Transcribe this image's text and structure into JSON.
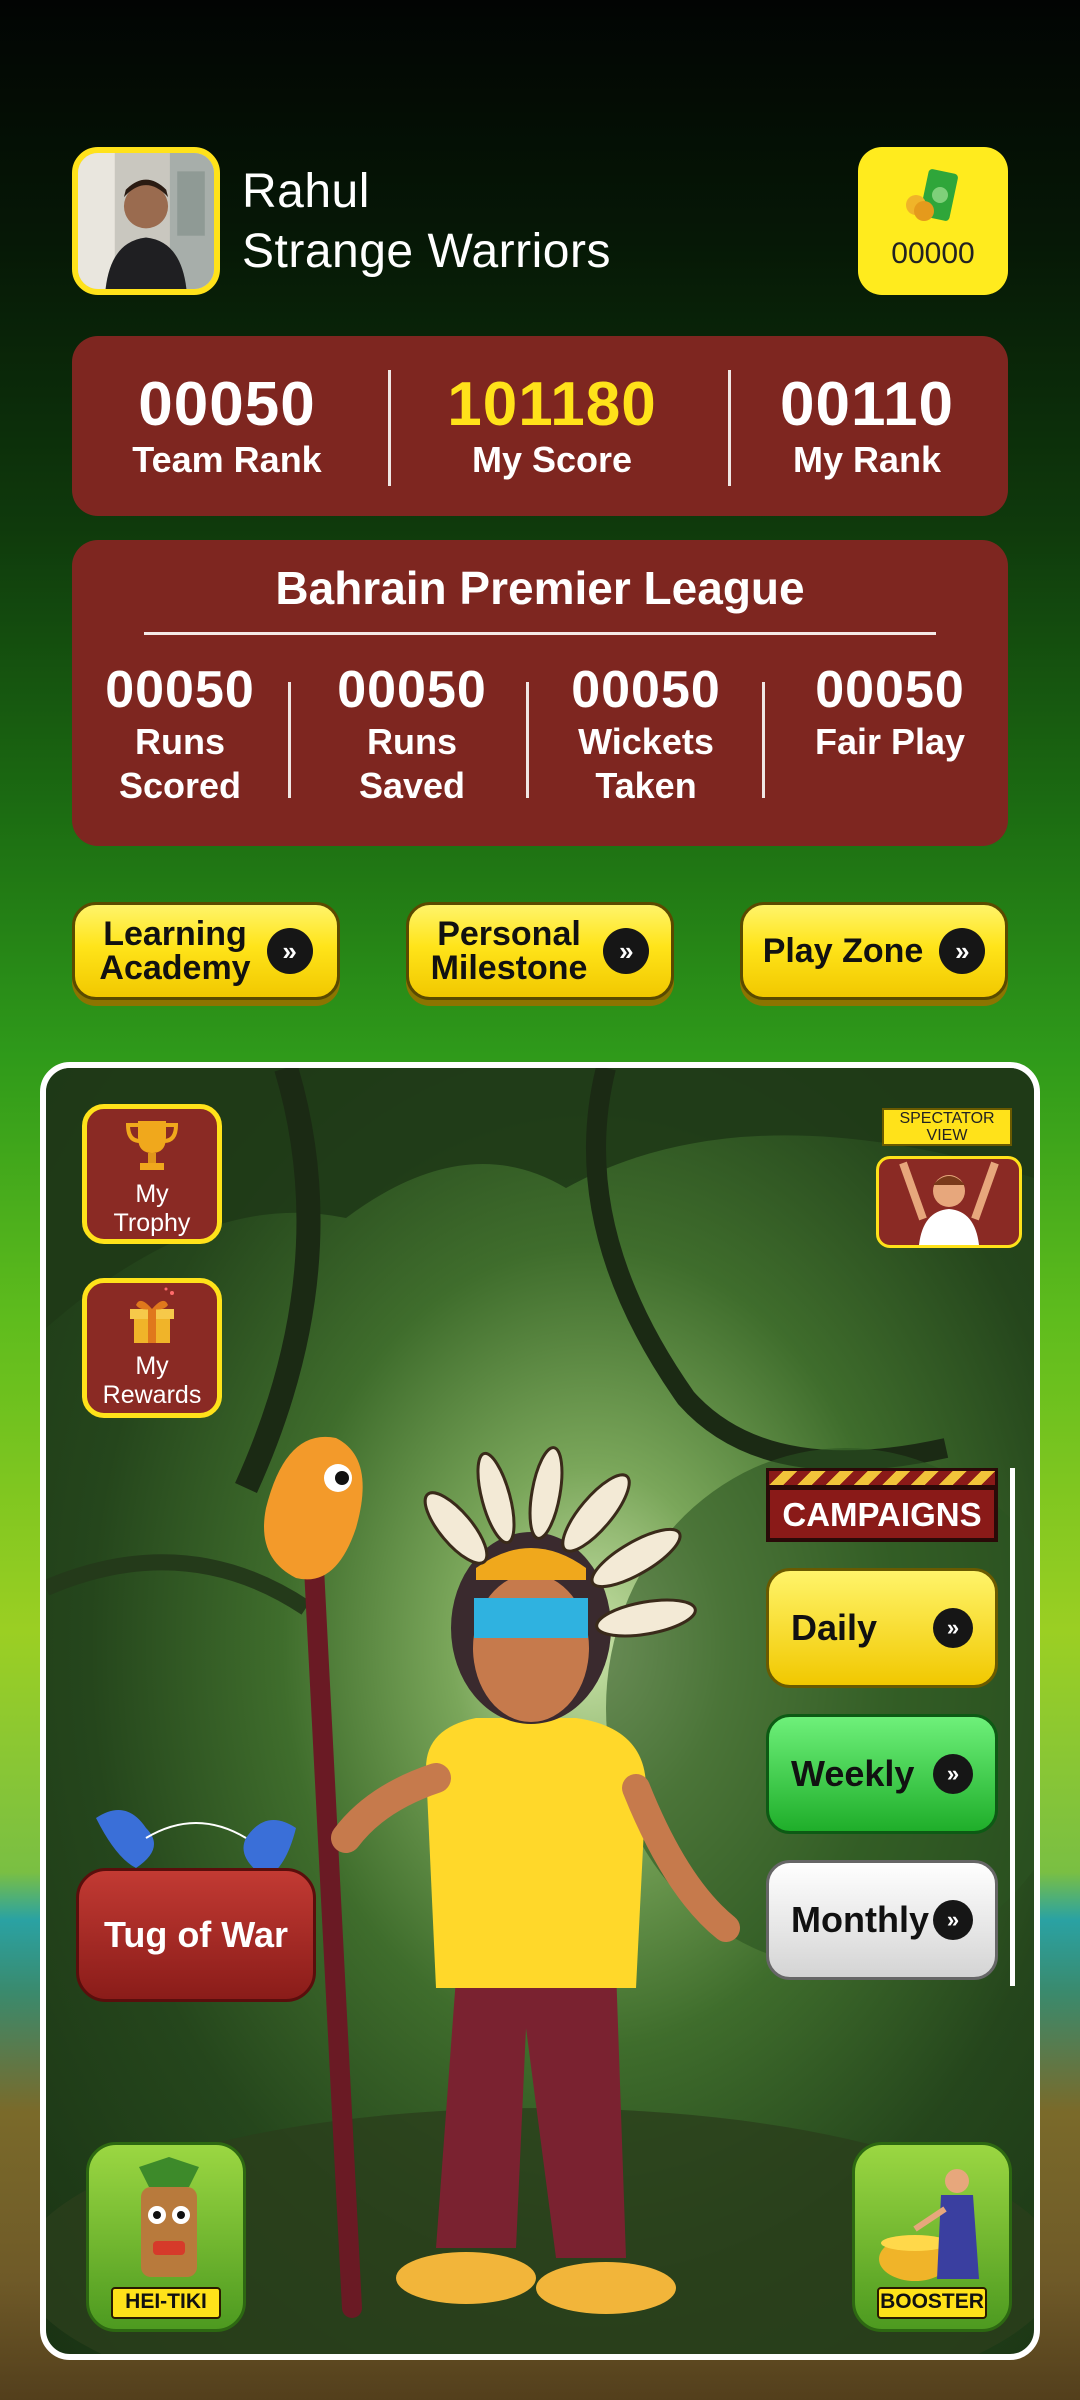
{
  "profile": {
    "name": "Rahul",
    "team": "Strange Warriors",
    "wallet_amount": "00000"
  },
  "scores": [
    {
      "value": "00050",
      "label": "Team Rank",
      "color": "#ffffff"
    },
    {
      "value": "101180",
      "label": "My Score",
      "color": "#ffe21a"
    },
    {
      "value": "00110",
      "label": "My Rank",
      "color": "#ffffff"
    }
  ],
  "league": {
    "title": "Bahrain Premier League",
    "stats": [
      {
        "value": "00050",
        "label1": "Runs",
        "label2": "Scored"
      },
      {
        "value": "00050",
        "label1": "Runs",
        "label2": "Saved"
      },
      {
        "value": "00050",
        "label1": "Wickets",
        "label2": "Taken"
      },
      {
        "value": "00050",
        "label1": "Fair Play",
        "label2": ""
      }
    ]
  },
  "nav": {
    "learning_line1": "Learning",
    "learning_line2": "Academy",
    "milestone_line1": "Personal",
    "milestone_line2": "Milestone",
    "play_zone": "Play Zone"
  },
  "game": {
    "trophy_line1": "My",
    "trophy_line2": "Trophy",
    "rewards_line1": "My",
    "rewards_line2": "Rewards",
    "spectator_line1": "SPECTATOR",
    "spectator_line2": "VIEW",
    "campaigns_label": "CAMPAIGNS",
    "daily": "Daily",
    "weekly": "Weekly",
    "monthly": "Monthly",
    "tug_of_war": "Tug of War",
    "hei_tiki": "HEI-TIKI",
    "booster": "BOOSTER"
  },
  "colors": {
    "card": "#7e2620",
    "accent_yellow": "#ffe21a",
    "weekly_green": "#2ec23a",
    "monthly_white": "#f2f2f2"
  },
  "icons": [
    "money-icon",
    "trophy-icon",
    "gift-icon",
    "double-chevron-right-icon",
    "spectator-icon",
    "bird-icon",
    "tiki-mask-icon",
    "cauldron-icon"
  ]
}
